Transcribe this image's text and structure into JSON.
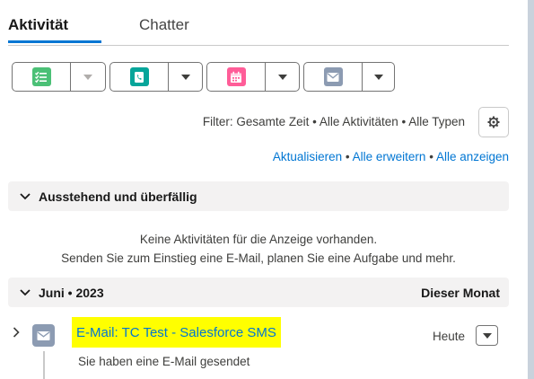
{
  "tabs": [
    {
      "label": "Aktivität",
      "active": true
    },
    {
      "label": "Chatter",
      "active": false
    }
  ],
  "actions": [
    {
      "icon": "task-list-icon",
      "color": "#4bc076",
      "dropdown_enabled": false
    },
    {
      "icon": "phone-call-icon",
      "color": "#06a59a",
      "dropdown_enabled": true
    },
    {
      "icon": "calendar-event-icon",
      "color": "#ff5d98",
      "dropdown_enabled": true
    },
    {
      "icon": "email-icon",
      "color": "#8c9bb2",
      "dropdown_enabled": true
    }
  ],
  "filter": {
    "text": "Filter: Gesamte Zeit • Alle Aktivitäten • Alle Typen"
  },
  "links": {
    "refresh": "Aktualisieren",
    "sep1": "•",
    "expand_all": "Alle erweitern",
    "sep2": "•",
    "view_all": "Alle anzeigen"
  },
  "sections": {
    "upcoming": {
      "title": "Ausstehend und überfällig",
      "empty_line1": "Keine Aktivitäten für die Anzeige vorhanden.",
      "empty_line2": "Senden Sie zum Einstieg eine E-Mail, planen Sie eine Aufgabe und mehr."
    },
    "month": {
      "title": "Juni • 2023",
      "badge": "Dieser Monat"
    }
  },
  "timeline_item": {
    "subject": "E-Mail: TC Test - Salesforce SMS",
    "date": "Heute",
    "description": "Sie haben eine E-Mail gesendet",
    "highlight_color": "#ffff00"
  },
  "colors": {
    "brand_blue": "#0176d3",
    "section_bg": "#f3f2f2"
  }
}
